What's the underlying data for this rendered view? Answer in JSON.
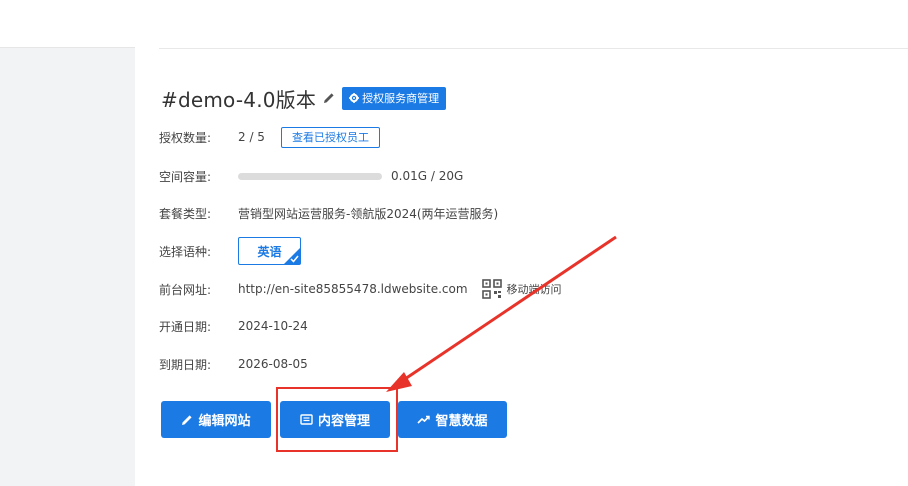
{
  "site": {
    "title": "#demo-4.0版本",
    "auth_button": "授权服务商管理"
  },
  "info": {
    "auth_count": {
      "label": "授权数量:",
      "value": "2 / 5",
      "button": "查看已授权员工"
    },
    "storage": {
      "label": "空间容量:",
      "text": "0.01G / 20G",
      "used_fraction": 0.0005
    },
    "package": {
      "label": "套餐类型:",
      "value": "营销型网站运营服务-领航版2024(两年运营服务)"
    },
    "language": {
      "label": "选择语种:",
      "selected": "英语"
    },
    "frontend_url": {
      "label": "前台网址:",
      "value": "http://en-site85855478.ldwebsite.com",
      "mobile_label": "移动端访问"
    },
    "open_date": {
      "label": "开通日期:",
      "value": "2024-10-24"
    },
    "expire_date": {
      "label": "到期日期:",
      "value": "2026-08-05"
    }
  },
  "actions": {
    "edit_site": "编辑网站",
    "content_manage": "内容管理",
    "smart_data": "智慧数据"
  },
  "colors": {
    "primary": "#1c7ae4",
    "annotation": "#e8332a"
  }
}
